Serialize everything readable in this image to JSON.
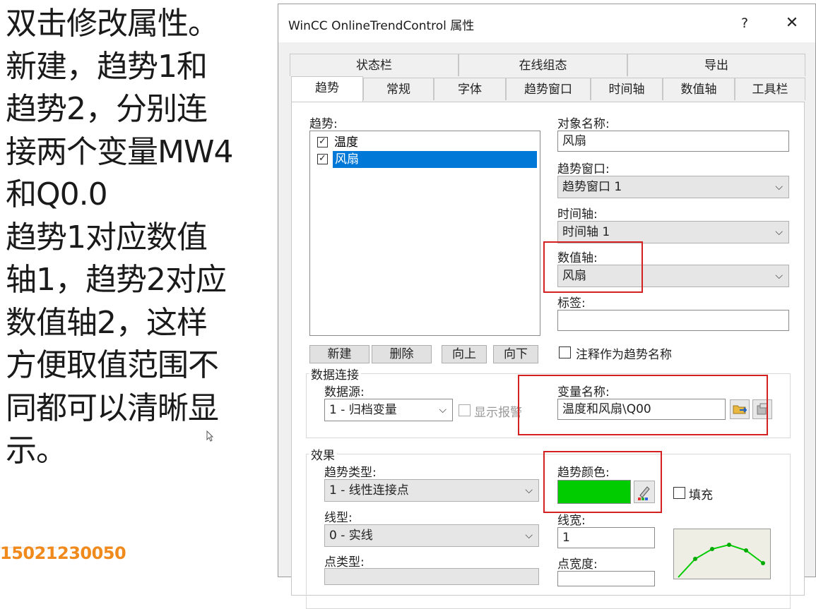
{
  "caption": {
    "lines": [
      "双击修改属性。",
      "新建，趋势1和",
      "趋势2，分别连",
      "接两个变量MW4",
      "和Q0.0",
      "趋势1对应数值",
      "轴1，趋势2对应",
      "数值轴2，这样",
      "方便取值范围不",
      "同都可以清晰显",
      "示。"
    ]
  },
  "phone": "15021230050",
  "dialog": {
    "title": "WinCC OnlineTrendControl 属性",
    "help": "?",
    "close": "✕",
    "tabs_row1": [
      "状态栏",
      "在线组态",
      "导出"
    ],
    "tabs_row2": [
      "趋势",
      "常规",
      "字体",
      "趋势窗口",
      "时间轴",
      "数值轴",
      "工具栏"
    ],
    "trend_list_label": "趋势:",
    "trends": [
      {
        "label": "温度",
        "checked": true,
        "selected": false
      },
      {
        "label": "风扇",
        "checked": true,
        "selected": true
      }
    ],
    "buttons": {
      "new": "新建",
      "delete": "删除",
      "up": "向上",
      "down": "向下"
    },
    "object_name_label": "对象名称:",
    "object_name_value": "风扇",
    "trend_window_label": "趋势窗口:",
    "trend_window_value": "趋势窗口 1",
    "time_axis_label": "时间轴:",
    "time_axis_value": "时间轴 1",
    "value_axis_label": "数值轴:",
    "value_axis_value": "风扇",
    "tag_label": "标签:",
    "tag_value": "",
    "comment_as_name": "注释作为趋势名称",
    "data_connection_group": "数据连接",
    "data_source_label": "数据源:",
    "data_source_value": "1 - 归档变量",
    "show_alarm": "显示报警",
    "variable_name_label": "变量名称:",
    "variable_name_value": "温度和风扇\\Q00",
    "effect_group": "效果",
    "trend_type_label": "趋势类型:",
    "trend_type_value": "1 - 线性连接点",
    "trend_color_label": "趋势颜色:",
    "trend_color": "#00cc00",
    "fill_label": "填充",
    "line_type_label": "线型:",
    "line_type_value": "0 - 实线",
    "line_width_label": "线宽:",
    "line_width_value": "1",
    "point_type_label": "点类型:",
    "point_width_label": "点宽度:"
  }
}
